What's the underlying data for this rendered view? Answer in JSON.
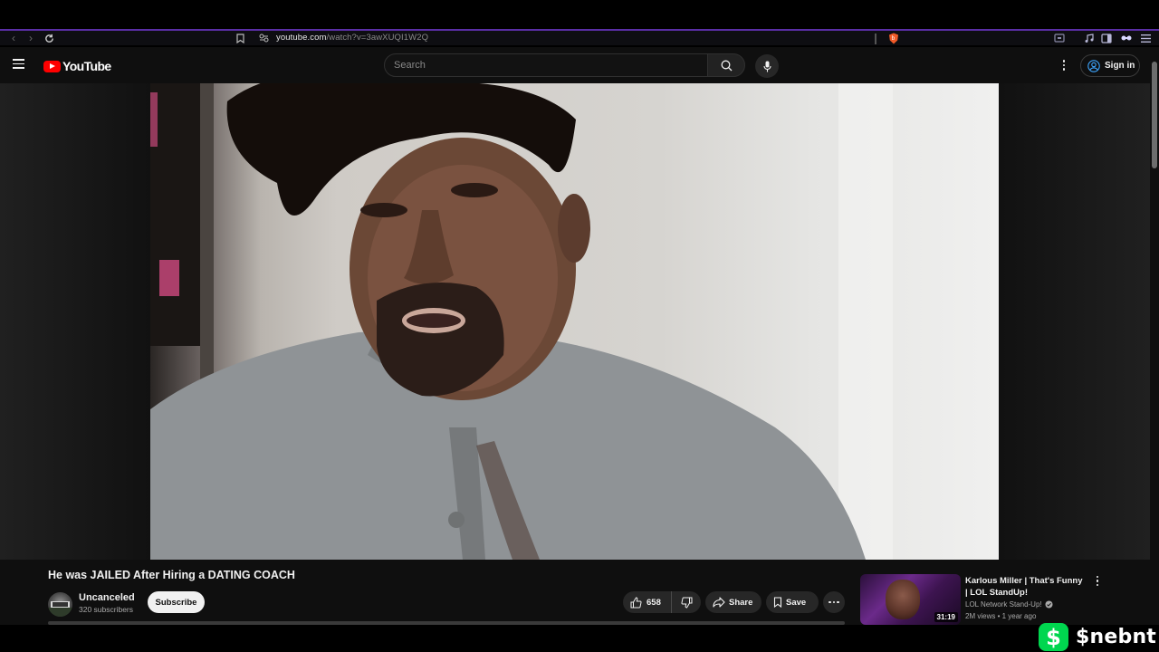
{
  "browser": {
    "url_host": "youtube.com",
    "url_path": "/watch?v=3awXUQI1W2Q"
  },
  "header": {
    "logo_text": "YouTube",
    "search_placeholder": "Search",
    "signin_label": "Sign in"
  },
  "video": {
    "title": "He was JAILED After Hiring a DATING COACH",
    "channel": "Uncanceled",
    "subscribers": "320 subscribers",
    "subscribe_label": "Subscribe",
    "likes": "658",
    "share_label": "Share",
    "save_label": "Save"
  },
  "recommended": {
    "title": "Karlous Miller | That's Funny | LOL StandUp!",
    "channel": "LOL Network Stand-Up!",
    "meta": "2M views • 1 year ago",
    "duration": "31:19"
  },
  "overlay": {
    "cashtag": "$nebnt",
    "cash_symbol": "$"
  },
  "colors": {
    "accent_bar": "#5a2ea6",
    "yt_red": "#ff0000",
    "cashapp_green": "#00d64f"
  }
}
